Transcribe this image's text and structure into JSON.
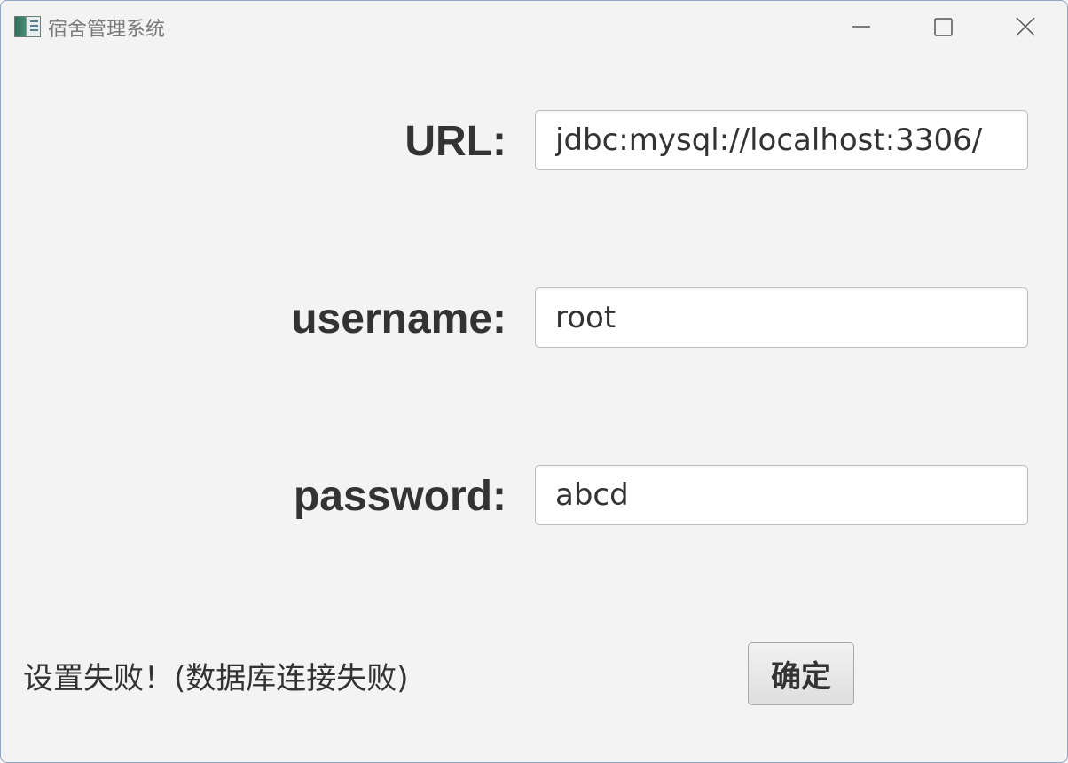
{
  "window": {
    "title": "宿舍管理系统",
    "icon": "app-table-icon"
  },
  "controls": {
    "minimize_icon": "minimize-icon",
    "maximize_icon": "maximize-icon",
    "close_icon": "close-icon"
  },
  "form": {
    "url_label": "URL:",
    "url_value": "jdbc:mysql://localhost:3306/",
    "username_label": "username:",
    "username_value": "root",
    "password_label": "password:",
    "password_value": "abcd"
  },
  "status": {
    "message": "设置失败！(数据库连接失败)"
  },
  "actions": {
    "confirm_label": "确定"
  }
}
